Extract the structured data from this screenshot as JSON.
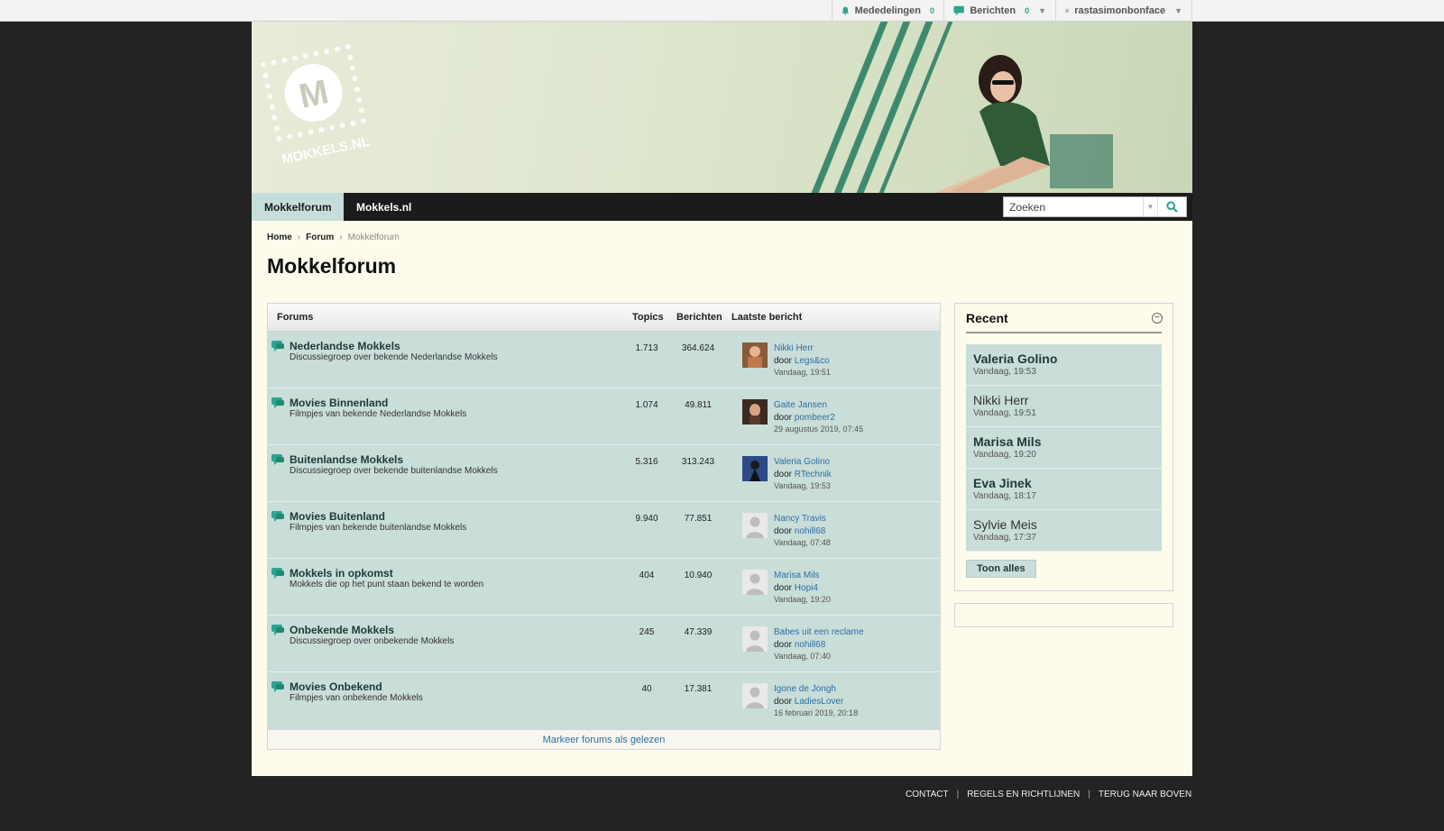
{
  "topbar": {
    "notifications": {
      "label": "Mededelingen",
      "count": "0"
    },
    "messages": {
      "label": "Berichten",
      "count": "0"
    },
    "user": {
      "label": "rastasimonbonface"
    }
  },
  "banner": {
    "logo_text": "MOKKELS.NL",
    "logo_letter": "M"
  },
  "nav": {
    "tabs": [
      {
        "label": "Mokkelforum",
        "active": true
      },
      {
        "label": "Mokkels.nl",
        "active": false
      }
    ],
    "search_placeholder": "Zoeken"
  },
  "breadcrumb": {
    "items": [
      "Home",
      "Forum"
    ],
    "current": "Mokkelforum"
  },
  "page_title": "Mokkelforum",
  "forum_table": {
    "headers": {
      "forums": "Forums",
      "topics": "Topics",
      "posts": "Berichten",
      "last": "Laatste bericht"
    },
    "by_label": "door",
    "rows": [
      {
        "title": "Nederlandse Mokkels",
        "desc": "Discussiegroep over bekende Nederlandse Mokkels",
        "topics": "1.713",
        "posts": "364.624",
        "last_title": "Nikki Herr",
        "last_user": "Legs&co",
        "last_date": "Vandaag, 19:51",
        "avatar": "photo-warm"
      },
      {
        "title": "Movies Binnenland",
        "desc": "Filmpjes van bekende Nederlandse Mokkels",
        "topics": "1.074",
        "posts": "49.811",
        "last_title": "Gaite Jansen",
        "last_user": "pombeer2",
        "last_date": "29 augustus 2019, 07:45",
        "avatar": "photo-dark"
      },
      {
        "title": "Buitenlandse Mokkels",
        "desc": "Discussiegroep over bekende buitenlandse Mokkels",
        "topics": "5.316",
        "posts": "313.243",
        "last_title": "Valeria Golino",
        "last_user": "RTechnik",
        "last_date": "Vandaag, 19:53",
        "avatar": "photo-blue"
      },
      {
        "title": "Movies Buitenland",
        "desc": "Filmpjes van bekende buitenlandse Mokkels",
        "topics": "9.940",
        "posts": "77.851",
        "last_title": "Nancy Travis",
        "last_user": "nohill68",
        "last_date": "Vandaag, 07:48",
        "avatar": "default"
      },
      {
        "title": "Mokkels in opkomst",
        "desc": "Mokkels die op het punt staan bekend te worden",
        "topics": "404",
        "posts": "10.940",
        "last_title": "Marisa Mils",
        "last_user": "Hopi4",
        "last_date": "Vandaag, 19:20",
        "avatar": "default"
      },
      {
        "title": "Onbekende Mokkels",
        "desc": "Discussiegroep over onbekende Mokkels",
        "topics": "245",
        "posts": "47.339",
        "last_title": "Babes uit een reclame",
        "last_user": "nohill68",
        "last_date": "Vandaag, 07:40",
        "avatar": "default"
      },
      {
        "title": "Movies Onbekend",
        "desc": "Filmpjes van onbekende Mokkels",
        "topics": "40",
        "posts": "17.381",
        "last_title": "Igone de Jongh",
        "last_user": "LadiesLover",
        "last_date": "16 februari 2019, 20:18",
        "avatar": "default"
      }
    ],
    "mark_read": "Markeer forums als gelezen"
  },
  "recent": {
    "title": "Recent",
    "items": [
      {
        "name": "Valeria Golino",
        "time": "Vandaag, 19:53",
        "unread": true
      },
      {
        "name": "Nikki Herr",
        "time": "Vandaag, 19:51",
        "unread": false
      },
      {
        "name": "Marisa Mils",
        "time": "Vandaag, 19:20",
        "unread": true
      },
      {
        "name": "Eva Jinek",
        "time": "Vandaag, 18:17",
        "unread": true
      },
      {
        "name": "Sylvie Meis",
        "time": "Vandaag, 17:37",
        "unread": false
      }
    ],
    "show_all": "Toon alles"
  },
  "footer": {
    "links": [
      "CONTACT",
      "REGELS EN RICHTLIJNEN",
      "TERUG NAAR BOVEN"
    ]
  },
  "colors": {
    "accent": "#2aa58f",
    "row_bg": "#c9ddd9",
    "page_bg": "#fcfbec",
    "body_bg": "#232323",
    "link": "#2d6fa3"
  }
}
